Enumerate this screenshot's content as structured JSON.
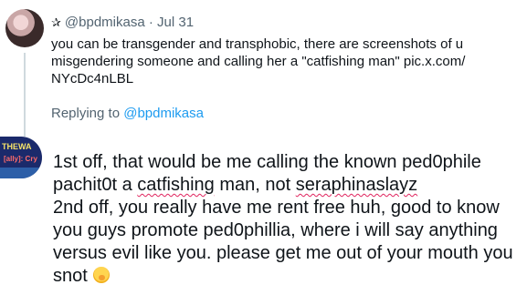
{
  "tweet": {
    "star": "✰",
    "handle": "@bpdmikasa",
    "separator": "·",
    "date": "Jul 31",
    "text_lines": [
      "you can be transgender and transphobic, there are screenshots of u",
      "misgendering someone and calling her a \"catfishing man\" pic.x.com/",
      "NYcDc4nLBL"
    ],
    "replying_prefix": "Replying to",
    "replying_handle": "@bpdmikasa"
  },
  "reply": {
    "avatar_text_top": "THEWA",
    "avatar_text_mid": "[ally]: Cry",
    "line1": "1st off, that would be me calling the known ped0phile",
    "line2_a": "pachit0t a ",
    "line2_b": "catfishing",
    "line2_c": " man, not ",
    "line2_d": "seraphinaslayz",
    "line3": "2nd off, you really have me rent free huh, good to know",
    "line4": "you guys promote ped0phillia, where i will say anything",
    "line5": "versus evil like you. please get me out of your mouth you",
    "line6": "snot",
    "emoji_name": "face-with-hand-over-mouth-emoji"
  },
  "colors": {
    "accent_link": "#1d9bf0",
    "muted_text": "#536471",
    "text": "#0f1419",
    "spellcheck": "#e0245e"
  }
}
